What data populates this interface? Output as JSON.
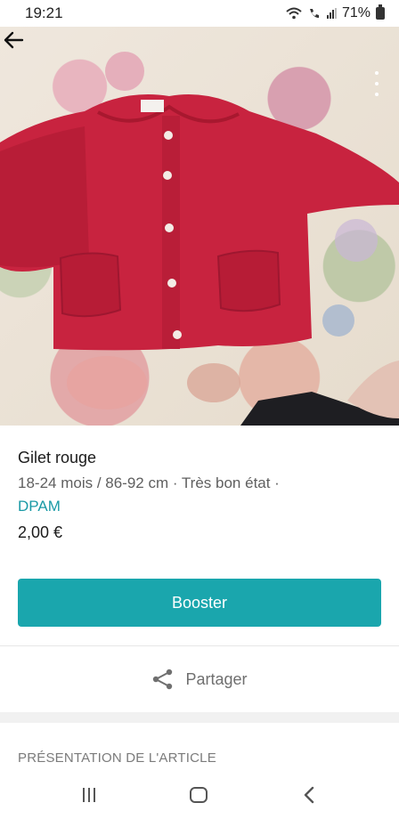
{
  "status_bar": {
    "time": "19:21",
    "battery": "71%"
  },
  "header": {
    "back_icon": "arrow-left-icon",
    "menu_icon": "more-vertical-icon"
  },
  "item": {
    "title": "Gilet rouge",
    "details": "18-24 mois / 86-92 cm · Très bon état ·",
    "brand": "DPAM",
    "price": "2,00 €"
  },
  "actions": {
    "boost_label": "Booster",
    "share_label": "Partager",
    "share_icon": "share-icon"
  },
  "sections": {
    "presentation_title": "PRÉSENTATION DE L'ARTICLE"
  },
  "colors": {
    "accent": "#1aa6ad",
    "brand_link": "#1a9aa6",
    "garment": "#c8233f"
  }
}
